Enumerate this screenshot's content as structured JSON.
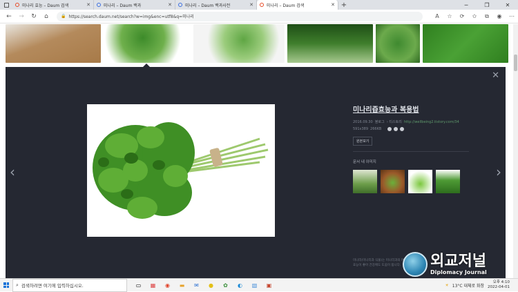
{
  "browser": {
    "tabs": [
      {
        "label": "미나리 효능 – Daum 검색",
        "active": false
      },
      {
        "label": "미나리 – Daum 백과",
        "active": false
      },
      {
        "label": "미나리 – Daum 백과사전",
        "active": false
      },
      {
        "label": "미나리 – Daum 검색",
        "active": true
      }
    ],
    "new_tab_label": "+",
    "url": "https://search.daum.net/search?w=img&enc=utf8&q=미나리"
  },
  "viewer": {
    "title": "미나리즙효능과 복용법",
    "date": "2016.09.30",
    "source_type": "블로그",
    "source_name": "티스토리",
    "source_url": "http://wellbeing2.tistory.com/34",
    "dimensions": "591x389",
    "file_size": "266KB",
    "original_button": "원본보기",
    "related_title": "문서 내 이미지",
    "caption": "미나리(미나리과 식물)는 미나리과의 여러해살이 풀이며 효능이 좋아 건강에도 도움이 됩니다."
  },
  "watermark": {
    "korean": "외교저널",
    "english": "Diplomacy Journal"
  },
  "taskbar": {
    "search_placeholder": "검색하려면 여기에 입력하십시오.",
    "weather": "13°C 대체로 화창",
    "time": "오후 4:10",
    "date": "2022-04-01"
  },
  "colors": {
    "viewer_bg": "#252832",
    "accent_green": "#5f9a6c"
  }
}
